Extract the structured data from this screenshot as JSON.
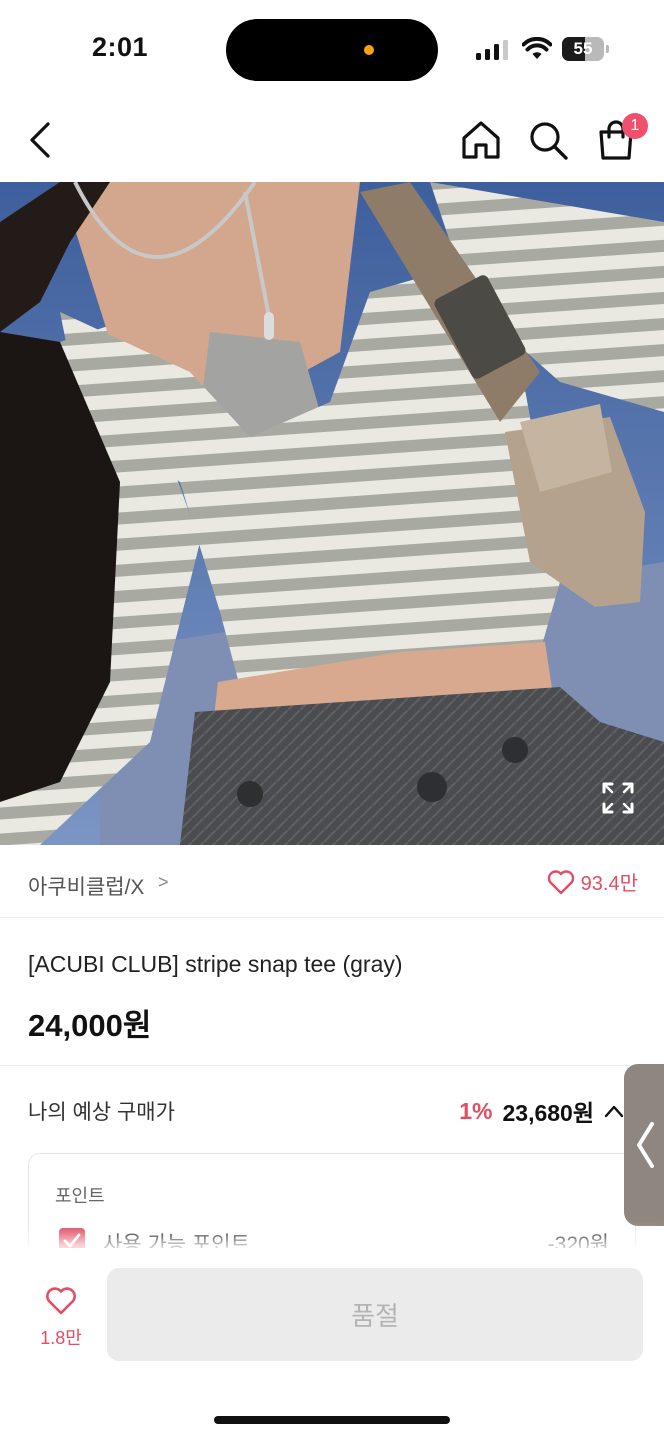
{
  "status_bar": {
    "time": "2:01",
    "battery": "55",
    "battery_level": 0.55
  },
  "nav": {
    "cart_count": "1"
  },
  "gallery": {
    "image_count": 2,
    "active_index": 0
  },
  "brand": {
    "name": "아쿠비클럽/X",
    "chevron": ">",
    "likes": "93.4만"
  },
  "product": {
    "title": "[ACUBI CLUB] stripe snap tee (gray)",
    "price": "24,000원"
  },
  "estimate": {
    "label": "나의 예상 구매가",
    "discount": "1%",
    "price": "23,680원"
  },
  "points": {
    "title": "포인트",
    "usable_label": "사용 가능 포인트",
    "usable_value": "-320원",
    "checked": true
  },
  "bottom": {
    "wish_count": "1.8만",
    "button_label": "품절"
  },
  "colors": {
    "accent": "#e24d63",
    "disabled_button": "#ebebeb",
    "disabled_text": "#b4b4b4"
  }
}
